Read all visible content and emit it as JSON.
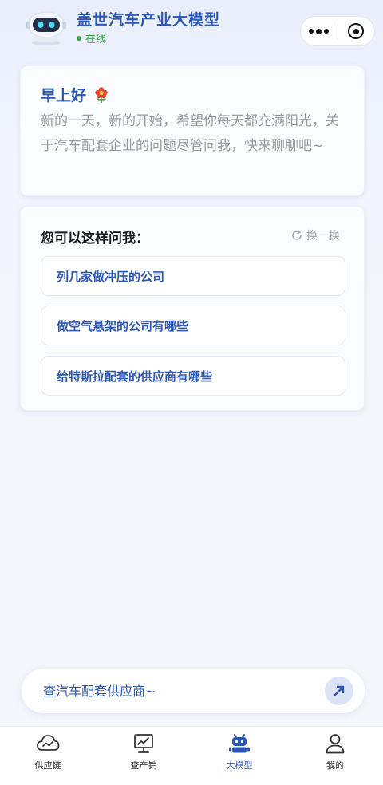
{
  "header": {
    "title": "盖世汽车产业大模型",
    "status": "在线",
    "more_icon": "more-dots-icon",
    "close_icon": "target-close-icon"
  },
  "greeting": {
    "title": "早上好",
    "icon": "flower-icon",
    "text": "新的一天，新的开始，希望你每天都充满阳光，关于汽车配套企业的问题尽管问我，快来聊聊吧~"
  },
  "suggestions": {
    "title": "您可以这样问我：",
    "refresh_label": "换一换",
    "items": [
      {
        "label": "列几家做冲压的公司"
      },
      {
        "label": "做空气悬架的公司有哪些"
      },
      {
        "label": "给特斯拉配套的供应商有哪些"
      }
    ]
  },
  "input": {
    "placeholder": "查汽车配套供应商~",
    "send_icon": "send-arrow-icon"
  },
  "tabbar": {
    "items": [
      {
        "label": "供应链",
        "icon": "cloud-chart-icon",
        "active": false
      },
      {
        "label": "查产销",
        "icon": "monitor-chart-icon",
        "active": false
      },
      {
        "label": "大模型",
        "icon": "robot-icon",
        "active": true
      },
      {
        "label": "我的",
        "icon": "user-icon",
        "active": false
      }
    ]
  },
  "colors": {
    "accent": "#2b56b8",
    "online": "#3aa34a",
    "muted_text": "#9a9a9a"
  }
}
